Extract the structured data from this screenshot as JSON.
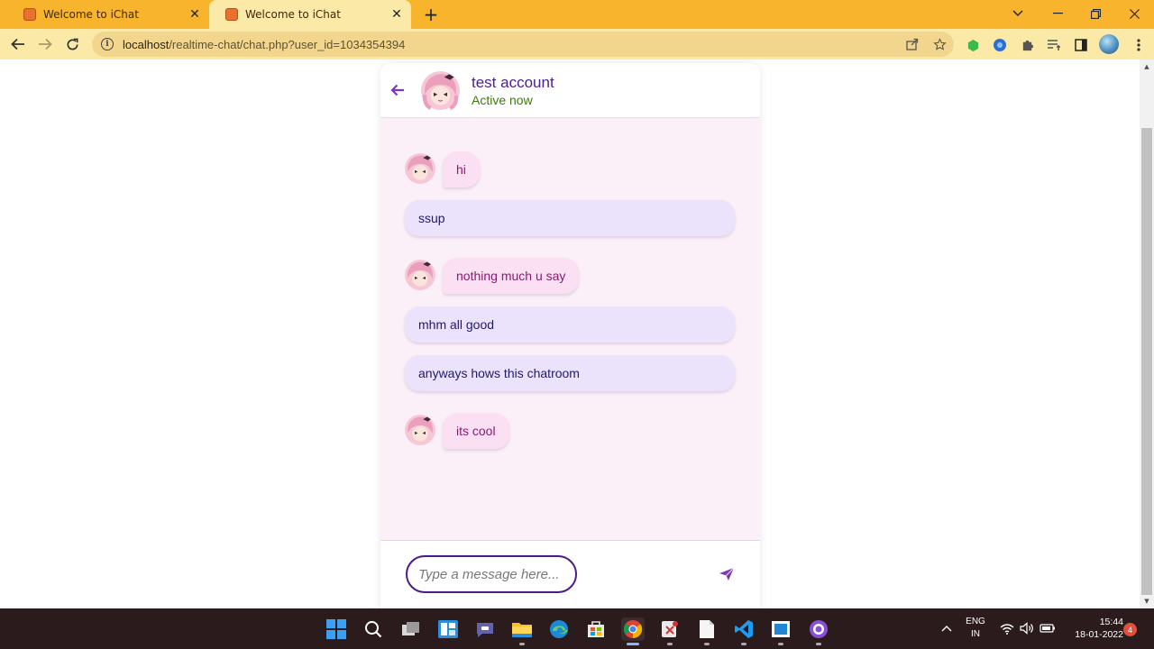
{
  "browser": {
    "tabs": [
      {
        "title": "Welcome to iChat",
        "active": false
      },
      {
        "title": "Welcome to iChat",
        "active": true
      }
    ],
    "address": {
      "host": "localhost",
      "path": "/realtime-chat/chat.php?user_id=1034354394"
    }
  },
  "chat": {
    "contact": {
      "name": "test account",
      "status": "Active now"
    },
    "messages": [
      {
        "direction": "incoming",
        "text": "hi"
      },
      {
        "direction": "outgoing",
        "text": "ssup"
      },
      {
        "direction": "incoming",
        "text": "nothing much u say"
      },
      {
        "direction": "outgoing",
        "text": "mhm all good"
      },
      {
        "direction": "outgoing",
        "text": "anyways hows this chatroom"
      },
      {
        "direction": "incoming",
        "text": "its cool"
      }
    ],
    "input": {
      "placeholder": "Type a message here...",
      "value": ""
    }
  },
  "colors": {
    "accent": "#4b1a8a",
    "incoming_bubble": "#fbe0f3",
    "outgoing_bubble": "#ebe2fb",
    "status": "#3d7a0a",
    "chat_background": "#fcf0f8",
    "tab_bar": "#f7b42c"
  },
  "taskbar": {
    "language": {
      "line1": "ENG",
      "line2": "IN"
    },
    "clock": {
      "time": "15:44",
      "date": "18-01-2022"
    },
    "notification_count": "4"
  }
}
